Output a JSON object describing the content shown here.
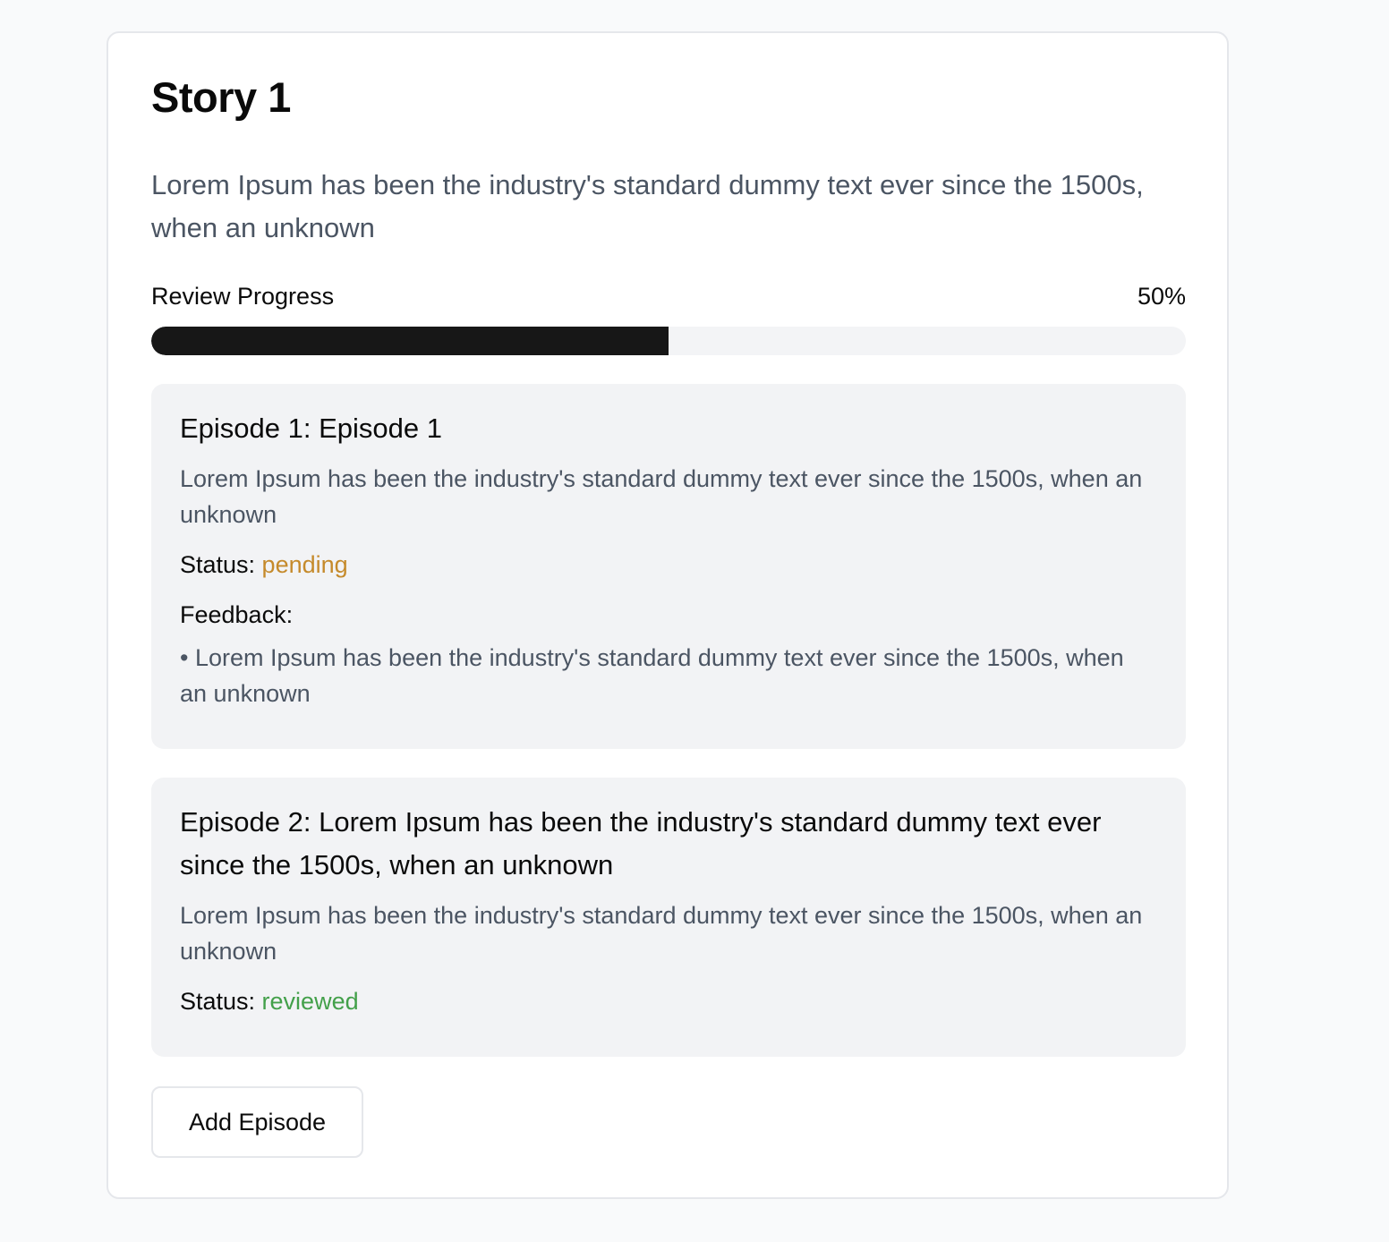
{
  "story": {
    "title": "Story 1",
    "description": "Lorem Ipsum has been the industry's standard dummy text ever since the 1500s, when an unknown"
  },
  "progress": {
    "label": "Review Progress",
    "value_text": "50%",
    "percent": 50
  },
  "episodes": [
    {
      "title": "Episode 1: Episode 1",
      "description": "Lorem Ipsum has been the industry's standard dummy text ever since the 1500s, when an unknown",
      "status_label": "Status: ",
      "status": "pending",
      "status_color": "#c58a2b",
      "feedback_label": "Feedback:",
      "feedback": [
        "• Lorem Ipsum has been the industry's standard dummy text ever since the 1500s, when an unknown"
      ]
    },
    {
      "title": "Episode 2: Lorem Ipsum has been the industry's standard dummy text ever since the 1500s, when an unknown",
      "description": "Lorem Ipsum has been the industry's standard dummy text ever since the 1500s, when an unknown",
      "status_label": "Status: ",
      "status": "reviewed",
      "status_color": "#43a04a"
    }
  ],
  "actions": {
    "add_episode_label": "Add Episode"
  }
}
